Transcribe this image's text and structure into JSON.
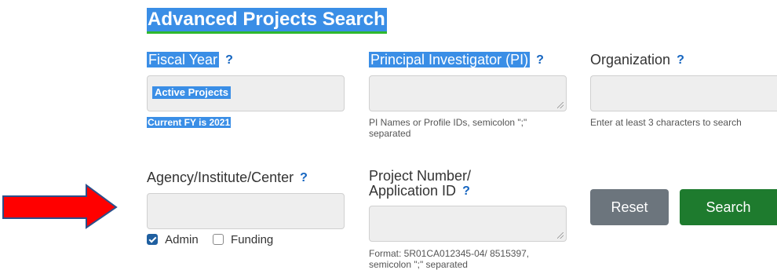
{
  "page": {
    "title": "Advanced Projects Search"
  },
  "fields": {
    "fiscal_year": {
      "label": "Fiscal Year",
      "help": "?",
      "value": "Active Projects",
      "hint": "Current FY is 2021"
    },
    "pi": {
      "label": "Principal Investigator (PI)",
      "help": "?",
      "value": "",
      "hint_line1": "PI Names or Profile IDs, semicolon \";\"",
      "hint_line2": "separated"
    },
    "organization": {
      "label": "Organization",
      "help": "?",
      "value": "",
      "hint": "Enter at least 3 characters to search"
    },
    "agency": {
      "label": "Agency/Institute/Center",
      "help": "?",
      "value": "",
      "options": [
        {
          "label": "Admin",
          "checked": true
        },
        {
          "label": "Funding",
          "checked": false
        }
      ]
    },
    "project_number": {
      "label_line1": "Project Number/",
      "label_line2": "Application ID",
      "help": "?",
      "value": "",
      "hint_line1": "Format: 5R01CA012345-04/ 8515397,",
      "hint_line2": "semicolon \";\" separated"
    }
  },
  "buttons": {
    "reset": "Reset",
    "search": "Search"
  },
  "colors": {
    "annotation_arrow": "#ff0000",
    "search_button": "#1e7b2e",
    "reset_button": "#6c757d",
    "selection": "#3a8ee6",
    "help_icon": "#1565c0"
  },
  "annotation": {
    "icon": "red-arrow-icon"
  }
}
